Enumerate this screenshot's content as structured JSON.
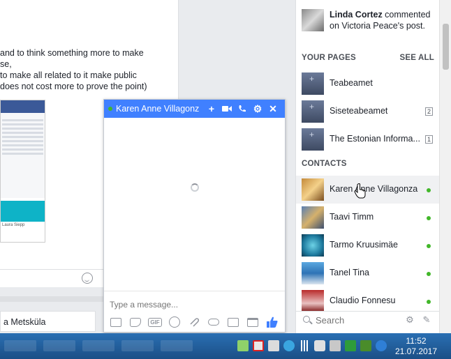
{
  "feed": {
    "post_lines": [
      " and to think something more to make",
      "se,",
      "to make all related to it make public",
      "does not cost more to prove the point)"
    ],
    "thumb_caption": "Laura Siepp",
    "next_post_name": "a Metsküla"
  },
  "chat": {
    "contact_name": "Karen Anne Villagonz",
    "input_placeholder": "Type a message...",
    "head_icons": [
      "plus-icon",
      "video-icon",
      "phone-icon",
      "gear-icon",
      "close-icon"
    ],
    "tool_icons": [
      "photo-icon",
      "sticker-icon",
      "gif-icon",
      "emoji-icon",
      "attachment-icon",
      "game-icon",
      "camera-icon",
      "calendar-icon"
    ],
    "accent_color": "#4080ff"
  },
  "sidebar": {
    "ticker": {
      "actor": "Linda Cortez",
      "text": " commented on Victoria Peace's post."
    },
    "pages_heading": "YOUR PAGES",
    "see_all": "SEE ALL",
    "pages": [
      {
        "name": "Teabeamet",
        "count": ""
      },
      {
        "name": "Siseteabeamet",
        "count": "2"
      },
      {
        "name": "The Estonian Informa...",
        "count": "1"
      }
    ],
    "contacts_heading": "CONTACTS",
    "contacts": [
      {
        "name": "Karen Anne Villagonza",
        "online": true
      },
      {
        "name": "Taavi Timm",
        "online": true
      },
      {
        "name": "Tarmo Kruusimäe",
        "online": true
      },
      {
        "name": "Tanel Tina",
        "online": true
      },
      {
        "name": "Claudio Fonnesu",
        "online": true
      }
    ],
    "search_placeholder": "Search"
  },
  "taskbar": {
    "time": "11:52",
    "date": "21.07.2017"
  }
}
